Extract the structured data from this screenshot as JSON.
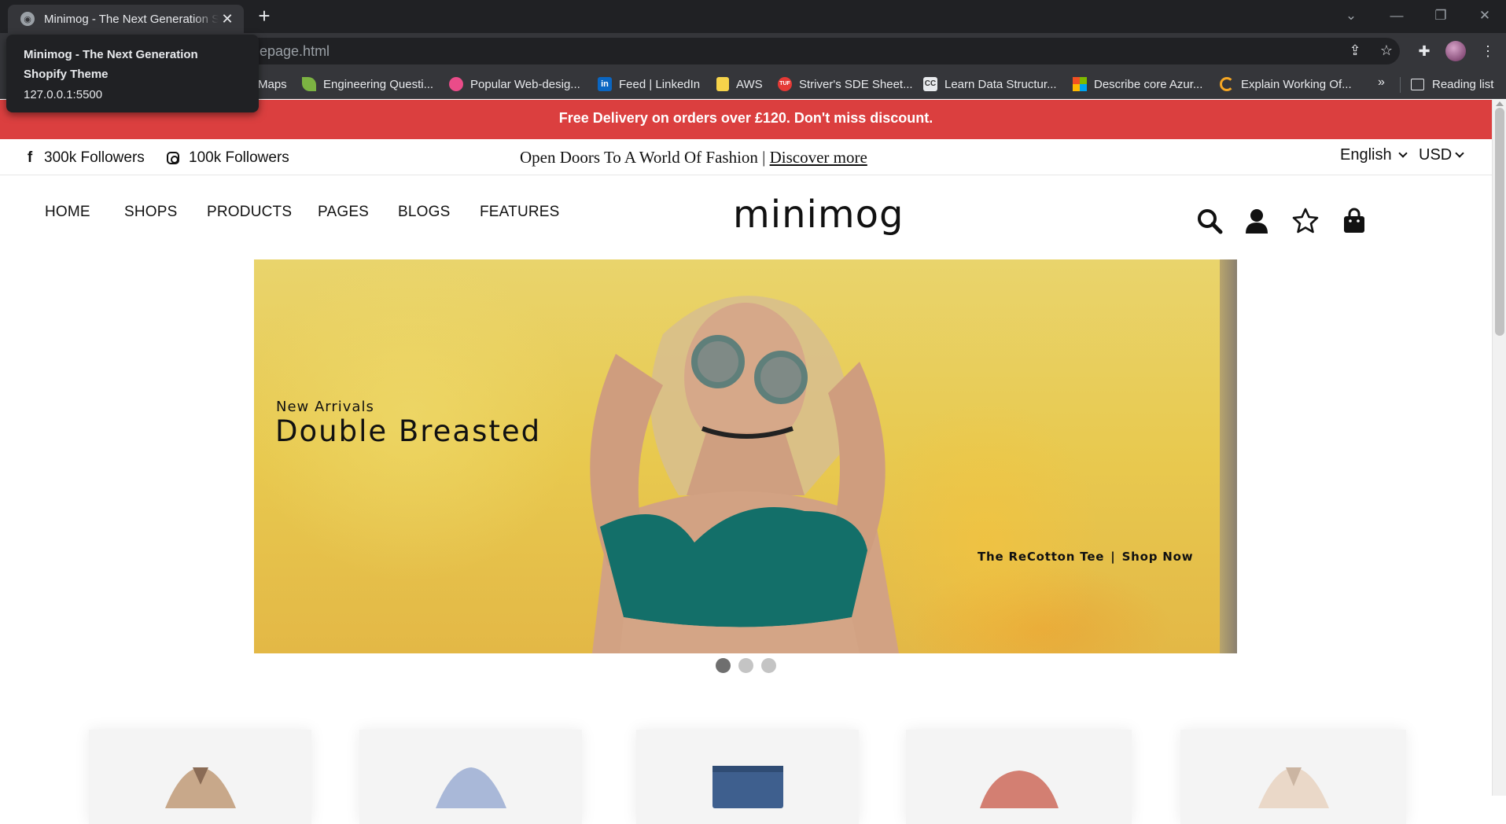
{
  "browser": {
    "tab_title": "Minimog - The Next Generation Shopify Theme",
    "new_tab_label": "+",
    "url_suffix": "epage.html",
    "tooltip": {
      "title_line1": "Minimog - The Next Generation",
      "title_line2": "Shopify Theme",
      "url": "127.0.0.1:5500"
    },
    "bookmarks": [
      {
        "label": "Maps",
        "icon": "maps-icon",
        "color": "#34a853"
      },
      {
        "label": "Engineering Questi...",
        "icon": "leaf-icon",
        "color": "#7cb342"
      },
      {
        "label": "Popular Web-desig...",
        "icon": "dribbble-icon",
        "color": "#ea4c89"
      },
      {
        "label": "Feed | LinkedIn",
        "icon": "linkedin-icon",
        "color": "#0a66c2"
      },
      {
        "label": "AWS",
        "icon": "folder-icon",
        "color": "#f6d34a"
      },
      {
        "label": "Striver's SDE Sheet...",
        "icon": "tuf-icon",
        "color": "#e53935"
      },
      {
        "label": "Learn Data Structur...",
        "icon": "cc-icon",
        "color": "#3c3c3c"
      },
      {
        "label": "Describe core Azur...",
        "icon": "microsoft-icon",
        "color": "#f25022"
      },
      {
        "label": "Explain Working Of...",
        "icon": "refresh-icon",
        "color": "#f5a623"
      }
    ],
    "more_bookmarks": "»",
    "reading_list": "Reading list"
  },
  "announcement": "Free Delivery on orders over £120. Don't miss discount.",
  "social": {
    "facebook": "300k Followers",
    "instagram": "100k Followers"
  },
  "promo": {
    "text": "Open Doors To A World Of Fashion | ",
    "link": "Discover more"
  },
  "locale": {
    "language": "English",
    "currency": "USD"
  },
  "nav": {
    "items": [
      "HOME",
      "SHOPS",
      "PRODUCTS",
      "PAGES",
      "BLOGS",
      "FEATURES"
    ]
  },
  "logo": "minimog",
  "hero": {
    "subtitle": "New Arrivals",
    "title": "Double Breasted",
    "product": "The ReCotton Tee",
    "cta": "Shop Now",
    "separator": "|",
    "slide_count": 3,
    "active_slide": 1
  },
  "colors": {
    "announcement_bg": "#db3f3f",
    "hero_bg": "#e8c94f"
  }
}
